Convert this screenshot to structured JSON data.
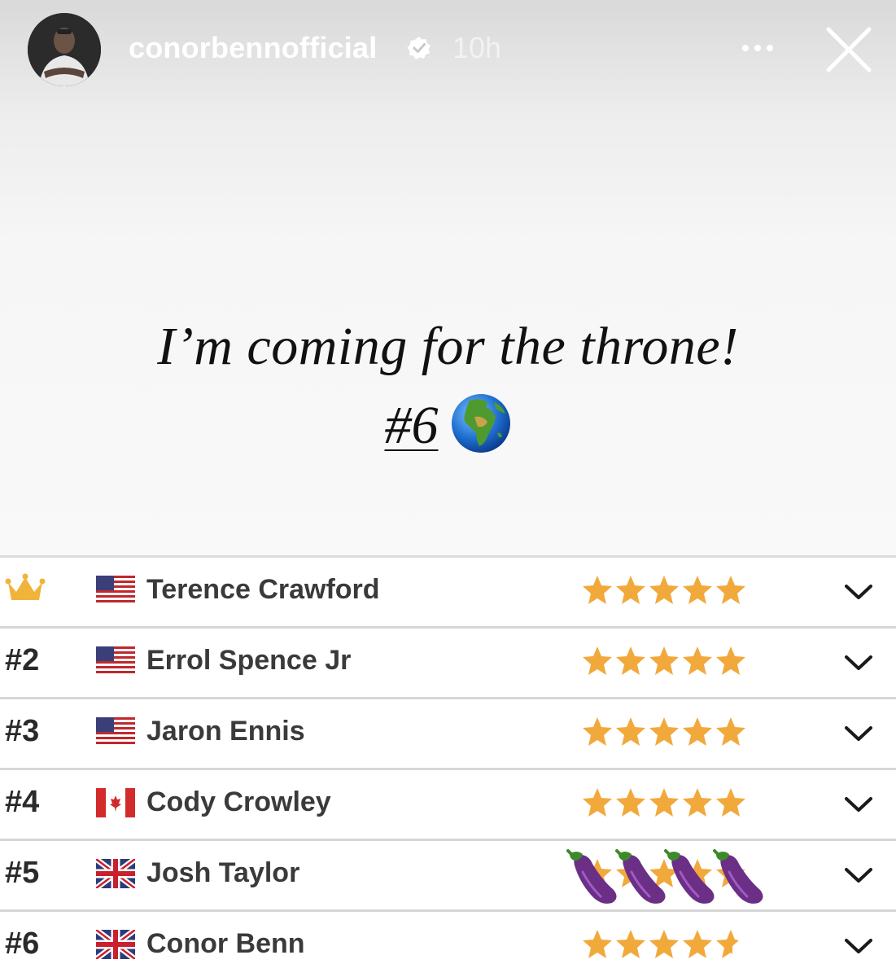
{
  "story": {
    "username": "conorbennofficial",
    "time_ago": "10h",
    "verified": true
  },
  "caption": {
    "line1": "I’m coming for the throne!",
    "tag": "#6"
  },
  "rankings": [
    {
      "rank": "",
      "crown": true,
      "flag": "usa",
      "name": "Terence Crawford",
      "rating_stars": 5,
      "eggplant_overlay": false
    },
    {
      "rank": "#2",
      "crown": false,
      "flag": "usa",
      "name": "Errol Spence Jr",
      "rating_stars": 5,
      "eggplant_overlay": false
    },
    {
      "rank": "#3",
      "crown": false,
      "flag": "usa",
      "name": "Jaron Ennis",
      "rating_stars": 5,
      "eggplant_overlay": false
    },
    {
      "rank": "#4",
      "crown": false,
      "flag": "canada",
      "name": "Cody Crowley",
      "rating_stars": 5,
      "eggplant_overlay": false
    },
    {
      "rank": "#5",
      "crown": false,
      "flag": "uk",
      "name": "Josh Taylor",
      "rating_stars": 5,
      "eggplant_overlay": true
    },
    {
      "rank": "#6",
      "crown": false,
      "flag": "uk",
      "name": "Conor Benn",
      "rating_stars": 4.5,
      "eggplant_overlay": false
    }
  ],
  "colors": {
    "star": "#f2a93b",
    "crown": "#f0b43a",
    "eggplant": "#6b2f86"
  }
}
